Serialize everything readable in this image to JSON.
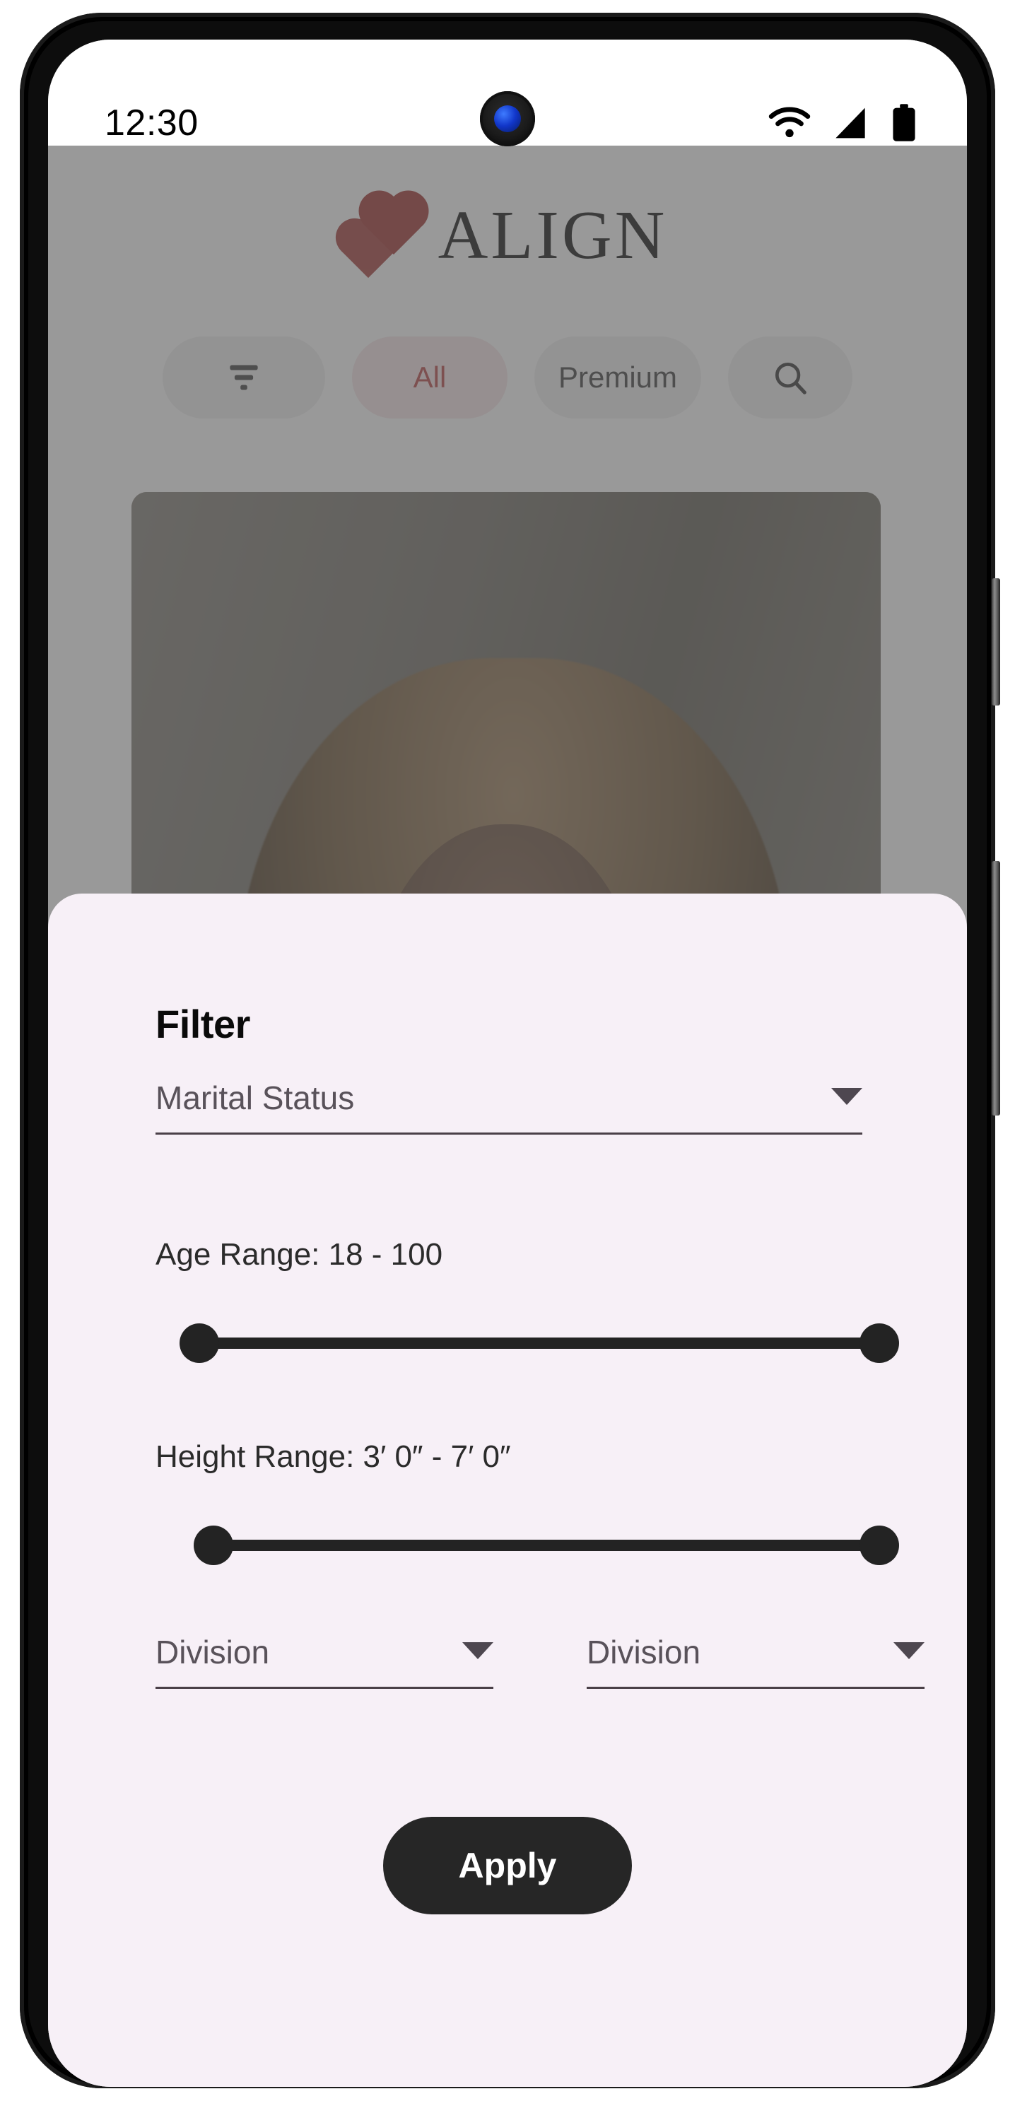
{
  "status_bar": {
    "time": "12:30",
    "icons": [
      "wifi-icon",
      "cellular-signal-icon",
      "battery-icon"
    ]
  },
  "app": {
    "brand_name": "ALIGN",
    "brand_hearts_color": "#9e2f2c",
    "chips": [
      {
        "id": "filter",
        "label": "",
        "icon": "filter-lines-icon"
      },
      {
        "id": "all",
        "label": "All",
        "icon": ""
      },
      {
        "id": "premium",
        "label": "Premium",
        "icon": ""
      },
      {
        "id": "search",
        "label": "",
        "icon": "search-icon"
      }
    ],
    "chip_all_color": "#b6403f"
  },
  "filter_sheet": {
    "title": "Filter",
    "marital_status": {
      "placeholder": "Marital Status",
      "value": ""
    },
    "age_range": {
      "label": "Age Range: 18 - 100",
      "min": 18,
      "max": 100
    },
    "height_range": {
      "label": "Height Range: 3′ 0″ - 7′ 0″",
      "min": "3′ 0″",
      "max": "7′ 0″"
    },
    "division_left": {
      "placeholder": "Division",
      "value": ""
    },
    "division_right": {
      "placeholder": "Division",
      "value": ""
    },
    "apply_label": "Apply",
    "sheet_background": "#f7f0f7",
    "apply_background": "#262626"
  }
}
